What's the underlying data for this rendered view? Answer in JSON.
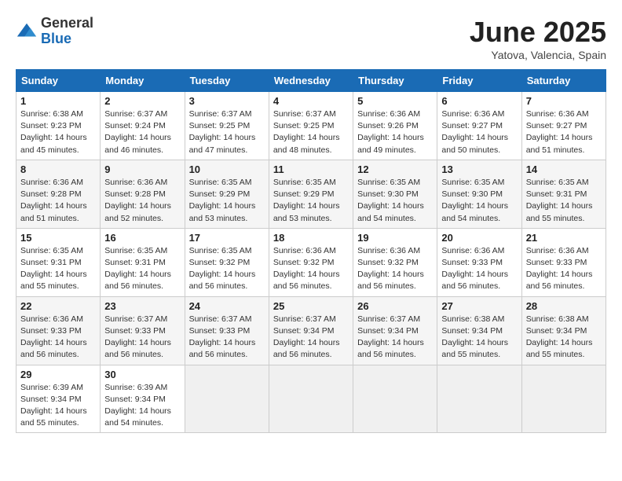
{
  "header": {
    "logo_general": "General",
    "logo_blue": "Blue",
    "month": "June 2025",
    "location": "Yatova, Valencia, Spain"
  },
  "weekdays": [
    "Sunday",
    "Monday",
    "Tuesday",
    "Wednesday",
    "Thursday",
    "Friday",
    "Saturday"
  ],
  "weeks": [
    [
      {
        "day": "1",
        "sunrise": "6:38 AM",
        "sunset": "9:23 PM",
        "daylight": "14 hours and 45 minutes."
      },
      {
        "day": "2",
        "sunrise": "6:37 AM",
        "sunset": "9:24 PM",
        "daylight": "14 hours and 46 minutes."
      },
      {
        "day": "3",
        "sunrise": "6:37 AM",
        "sunset": "9:25 PM",
        "daylight": "14 hours and 47 minutes."
      },
      {
        "day": "4",
        "sunrise": "6:37 AM",
        "sunset": "9:25 PM",
        "daylight": "14 hours and 48 minutes."
      },
      {
        "day": "5",
        "sunrise": "6:36 AM",
        "sunset": "9:26 PM",
        "daylight": "14 hours and 49 minutes."
      },
      {
        "day": "6",
        "sunrise": "6:36 AM",
        "sunset": "9:27 PM",
        "daylight": "14 hours and 50 minutes."
      },
      {
        "day": "7",
        "sunrise": "6:36 AM",
        "sunset": "9:27 PM",
        "daylight": "14 hours and 51 minutes."
      }
    ],
    [
      {
        "day": "8",
        "sunrise": "6:36 AM",
        "sunset": "9:28 PM",
        "daylight": "14 hours and 51 minutes."
      },
      {
        "day": "9",
        "sunrise": "6:36 AM",
        "sunset": "9:28 PM",
        "daylight": "14 hours and 52 minutes."
      },
      {
        "day": "10",
        "sunrise": "6:35 AM",
        "sunset": "9:29 PM",
        "daylight": "14 hours and 53 minutes."
      },
      {
        "day": "11",
        "sunrise": "6:35 AM",
        "sunset": "9:29 PM",
        "daylight": "14 hours and 53 minutes."
      },
      {
        "day": "12",
        "sunrise": "6:35 AM",
        "sunset": "9:30 PM",
        "daylight": "14 hours and 54 minutes."
      },
      {
        "day": "13",
        "sunrise": "6:35 AM",
        "sunset": "9:30 PM",
        "daylight": "14 hours and 54 minutes."
      },
      {
        "day": "14",
        "sunrise": "6:35 AM",
        "sunset": "9:31 PM",
        "daylight": "14 hours and 55 minutes."
      }
    ],
    [
      {
        "day": "15",
        "sunrise": "6:35 AM",
        "sunset": "9:31 PM",
        "daylight": "14 hours and 55 minutes."
      },
      {
        "day": "16",
        "sunrise": "6:35 AM",
        "sunset": "9:31 PM",
        "daylight": "14 hours and 56 minutes."
      },
      {
        "day": "17",
        "sunrise": "6:35 AM",
        "sunset": "9:32 PM",
        "daylight": "14 hours and 56 minutes."
      },
      {
        "day": "18",
        "sunrise": "6:36 AM",
        "sunset": "9:32 PM",
        "daylight": "14 hours and 56 minutes."
      },
      {
        "day": "19",
        "sunrise": "6:36 AM",
        "sunset": "9:32 PM",
        "daylight": "14 hours and 56 minutes."
      },
      {
        "day": "20",
        "sunrise": "6:36 AM",
        "sunset": "9:33 PM",
        "daylight": "14 hours and 56 minutes."
      },
      {
        "day": "21",
        "sunrise": "6:36 AM",
        "sunset": "9:33 PM",
        "daylight": "14 hours and 56 minutes."
      }
    ],
    [
      {
        "day": "22",
        "sunrise": "6:36 AM",
        "sunset": "9:33 PM",
        "daylight": "14 hours and 56 minutes."
      },
      {
        "day": "23",
        "sunrise": "6:37 AM",
        "sunset": "9:33 PM",
        "daylight": "14 hours and 56 minutes."
      },
      {
        "day": "24",
        "sunrise": "6:37 AM",
        "sunset": "9:33 PM",
        "daylight": "14 hours and 56 minutes."
      },
      {
        "day": "25",
        "sunrise": "6:37 AM",
        "sunset": "9:34 PM",
        "daylight": "14 hours and 56 minutes."
      },
      {
        "day": "26",
        "sunrise": "6:37 AM",
        "sunset": "9:34 PM",
        "daylight": "14 hours and 56 minutes."
      },
      {
        "day": "27",
        "sunrise": "6:38 AM",
        "sunset": "9:34 PM",
        "daylight": "14 hours and 55 minutes."
      },
      {
        "day": "28",
        "sunrise": "6:38 AM",
        "sunset": "9:34 PM",
        "daylight": "14 hours and 55 minutes."
      }
    ],
    [
      {
        "day": "29",
        "sunrise": "6:39 AM",
        "sunset": "9:34 PM",
        "daylight": "14 hours and 55 minutes."
      },
      {
        "day": "30",
        "sunrise": "6:39 AM",
        "sunset": "9:34 PM",
        "daylight": "14 hours and 54 minutes."
      },
      null,
      null,
      null,
      null,
      null
    ]
  ]
}
